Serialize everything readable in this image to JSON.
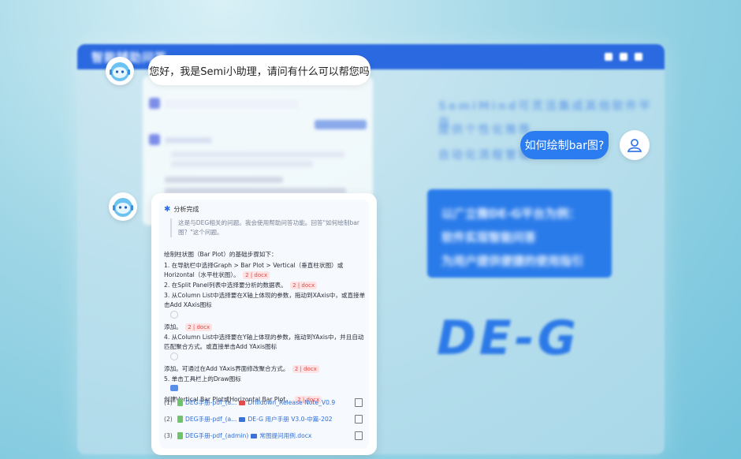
{
  "background": {
    "title": "智能辅助问答",
    "lines": [
      "SemiMind可灵活集成其他软件平台",
      "提供个性化推荐",
      "自动化流程管理"
    ],
    "panel_lines": [
      "以广立微DE-G平台为例：",
      "软件实现智能问答",
      "为用户提供便捷的使用指引"
    ],
    "logo": "DE-G"
  },
  "greeting": "您好，我是Semi小助理，请问有什么可以帮您吗",
  "question": "如何绘制bar图?",
  "answer": {
    "status": "分析完成",
    "quote": "这是与DEG相关的问题。我会使用帮助问答功能。回答\"如何绘制bar图？\"这个问题。",
    "intro": "绘制柱状图（Bar Plot）的基础步骤如下：",
    "steps": [
      {
        "text": "1. 在导航栏中选择Graph > Bar Plot > Vertical（垂直柱状图）或Horizontal（水平柱状图）。",
        "tag": "2 | docx"
      },
      {
        "text": "2. 在Split Panel列表中选择要分析的数据表。",
        "tag": "2 | docx"
      },
      {
        "text": "3. 从Column List中选择要在X轴上体现的参数，拖动到XAxis中，或直接单击Add XAxis图标",
        "after": "添加。",
        "tag": "2 | docx"
      },
      {
        "text": "4. 从Column List中选择要在Y轴上体现的参数，拖动到YAxis中，并且自动匹配聚合方式。或直接单击Add YAxis图标",
        "after": "添加。可通过在Add YAxis界面修改聚合方式。",
        "tag": "2 | docx"
      },
      {
        "text": "5. 单击工具栏上的Draw图标",
        "after": "创建Vertical Bar Plot或Horizontal Bar Plot。",
        "tag": "2 | docx"
      }
    ],
    "refs": [
      {
        "num": "(1)",
        "a": "DEG手册-pdf_(a...",
        "b": "Drilldown_Release Note_V0.9"
      },
      {
        "num": "(2)",
        "a": "DEG手册-pdf_(a...",
        "b": "DE-G 用户手册 V3.0-中篇-202"
      },
      {
        "num": "(3)",
        "a": "DEG手册-pdf_(admin)",
        "b": "常图提问用例.docx"
      }
    ]
  }
}
